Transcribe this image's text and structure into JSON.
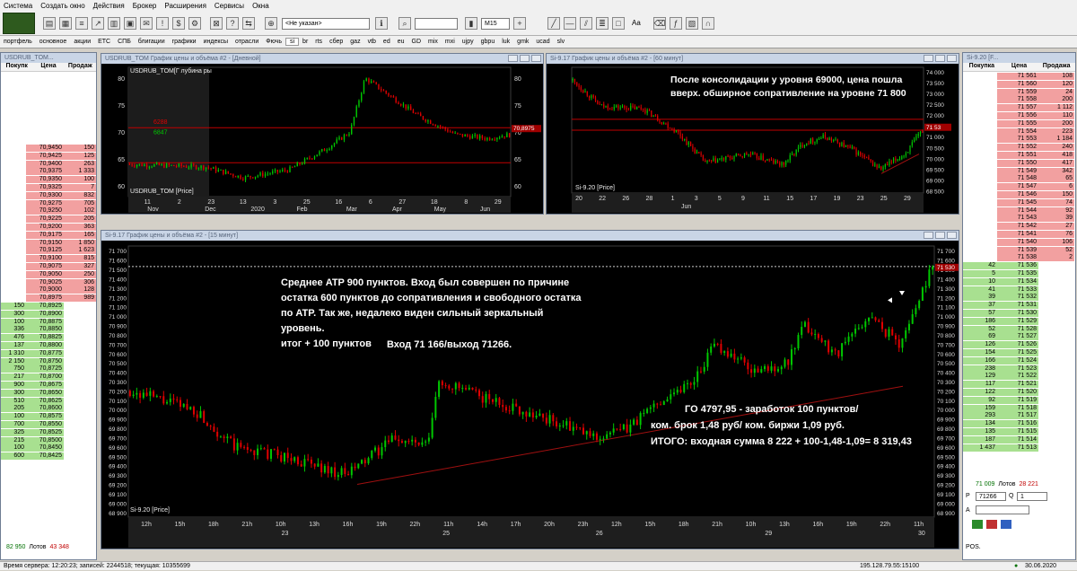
{
  "menu": [
    "Система",
    "Создать окно",
    "Действия",
    "Брокер",
    "Расширения",
    "Сервисы",
    "Окна"
  ],
  "toolbar": {
    "instrument": "<Не указан>",
    "timeframe": "M15",
    "aa": "Aa"
  },
  "tabs": [
    "портфель",
    "основное",
    "акции",
    "ETC",
    "СПБ",
    "блигации",
    "графики",
    "индексы",
    "отрасли",
    "Фючь",
    "si",
    "br",
    "rts",
    "сбер",
    "gaz",
    "vtb",
    "ed",
    "eu",
    "GD",
    "mix",
    "mxi",
    "ujpy",
    "gbpu",
    "luk",
    "gmk",
    "ucad",
    "slv"
  ],
  "left_dom": {
    "title": "USDRUB_TOM...",
    "headers": [
      "Покупк",
      "Цена",
      "Продаж"
    ],
    "asks": [
      [
        "70,9450",
        "150"
      ],
      [
        "70,9425",
        "125"
      ],
      [
        "70,9400",
        "263"
      ],
      [
        "70,9375",
        "1 333"
      ],
      [
        "70,9350",
        "100"
      ],
      [
        "70,9325",
        "7"
      ],
      [
        "70,9300",
        "832"
      ],
      [
        "70,9275",
        "705"
      ],
      [
        "70,9250",
        "102"
      ],
      [
        "70,9225",
        "205"
      ],
      [
        "70,9200",
        "363"
      ],
      [
        "70,9175",
        "165"
      ],
      [
        "70,9150",
        "1 850"
      ],
      [
        "70,9125",
        "1 623"
      ],
      [
        "70,9100",
        "815"
      ],
      [
        "70,9075",
        "327"
      ],
      [
        "70,9050",
        "250"
      ],
      [
        "70,9025",
        "306"
      ],
      [
        "70,9000",
        "128"
      ],
      [
        "70,8975",
        "989"
      ]
    ],
    "bids": [
      [
        "150",
        "70,8925"
      ],
      [
        "300",
        "70,8900"
      ],
      [
        "100",
        "70,8875"
      ],
      [
        "336",
        "70,8850"
      ],
      [
        "476",
        "70,8825"
      ],
      [
        "137",
        "70,8800"
      ],
      [
        "1 310",
        "70,8775"
      ],
      [
        "2 150",
        "70,8750"
      ],
      [
        "750",
        "70,8725"
      ],
      [
        "217",
        "70,8700"
      ],
      [
        "900",
        "70,8675"
      ],
      [
        "300",
        "70,8650"
      ],
      [
        "510",
        "70,8625"
      ],
      [
        "205",
        "70,8600"
      ],
      [
        "100",
        "70,8575"
      ],
      [
        "700",
        "70,8550"
      ],
      [
        "325",
        "70,8525"
      ],
      [
        "215",
        "70,8500"
      ],
      [
        "100",
        "70,8450"
      ],
      [
        "600",
        "70,8425"
      ]
    ],
    "totals": {
      "bid": "82 950",
      "label": "Лотов",
      "ask": "43 348"
    }
  },
  "right_dom": {
    "title": "Si-9.20 [F...",
    "headers": [
      "Покупка",
      "Цена",
      "Продажа"
    ],
    "asks": [
      [
        "71 561",
        "108"
      ],
      [
        "71 560",
        "120"
      ],
      [
        "71 559",
        "24"
      ],
      [
        "71 558",
        "200"
      ],
      [
        "71 557",
        "1 112"
      ],
      [
        "71 556",
        "110"
      ],
      [
        "71 555",
        "200"
      ],
      [
        "71 554",
        "223"
      ],
      [
        "71 553",
        "1 184"
      ],
      [
        "71 552",
        "240"
      ],
      [
        "71 551",
        "418"
      ],
      [
        "71 550",
        "417"
      ],
      [
        "71 549",
        "342"
      ],
      [
        "71 548",
        "65"
      ],
      [
        "71 547",
        "6"
      ],
      [
        "71 546",
        "150"
      ],
      [
        "71 545",
        "74"
      ],
      [
        "71 544",
        "92"
      ],
      [
        "71 543",
        "39"
      ],
      [
        "71 542",
        "27"
      ],
      [
        "71 541",
        "76"
      ],
      [
        "71 540",
        "106"
      ],
      [
        "71 539",
        "52"
      ],
      [
        "71 538",
        "2"
      ]
    ],
    "bids": [
      [
        "42",
        "71 536"
      ],
      [
        "5",
        "71 535"
      ],
      [
        "10",
        "71 534"
      ],
      [
        "41",
        "71 533"
      ],
      [
        "39",
        "71 532"
      ],
      [
        "37",
        "71 531"
      ],
      [
        "57",
        "71 530"
      ],
      [
        "186",
        "71 529"
      ],
      [
        "52",
        "71 528"
      ],
      [
        "69",
        "71 527"
      ],
      [
        "126",
        "71 526"
      ],
      [
        "154",
        "71 525"
      ],
      [
        "166",
        "71 524"
      ],
      [
        "238",
        "71 523"
      ],
      [
        "129",
        "71 522"
      ],
      [
        "117",
        "71 521"
      ],
      [
        "122",
        "71 520"
      ],
      [
        "92",
        "71 519"
      ],
      [
        "159",
        "71 518"
      ],
      [
        "293",
        "71 517"
      ],
      [
        "134",
        "71 516"
      ],
      [
        "135",
        "71 515"
      ],
      [
        "187",
        "71 514"
      ],
      [
        "1 437",
        "71 513"
      ]
    ],
    "totals": {
      "bid": "71 009",
      "label": "Лотов",
      "ask": "28 221"
    },
    "order": {
      "p_label": "P",
      "price": "71266",
      "q_label": "Q",
      "qty": "1",
      "a_label": "A",
      "pos_label": "POS."
    }
  },
  "chart1": {
    "title": "USDRUB_TOM График цены и объёма #2 - [Дневной]",
    "legend_top": "USDRUB_TOM[Г лубина ры",
    "legend_bottom": "USDRUB_TOM [Price]",
    "level1": "6288",
    "level2": "6847",
    "price_tag": "70,8975",
    "yticks": [
      "80",
      "75",
      "70",
      "65",
      "60"
    ],
    "xticks": [
      "11",
      "2",
      "23",
      "13",
      "3",
      "25",
      "16",
      "6",
      "27",
      "18",
      "8",
      "29"
    ],
    "months": [
      "Nov",
      "Dec",
      "2020",
      "Feb",
      "Mar",
      "Apr",
      "May",
      "Jun"
    ]
  },
  "chart2": {
    "title": "Si-9.17 График цены и объёма #2 - [60 минут]",
    "legend": "Si-9.20 [Price]",
    "price_tag": "71 53",
    "annotation": [
      "После консолидации у уровня 69000, цена пошла",
      "вверх.  обширное сопративление на уровне 71 800"
    ],
    "yticks": [
      "74 000",
      "73 500",
      "73 000",
      "72 500",
      "72 000",
      "71 500",
      "71 000",
      "70 500",
      "70 000",
      "69 500",
      "69 000",
      "68 500"
    ],
    "xticks": [
      "20",
      "22",
      "26",
      "28",
      "1",
      "3",
      "5",
      "9",
      "11",
      "15",
      "17",
      "19",
      "23",
      "25",
      "29"
    ],
    "month": "Jun"
  },
  "chart3": {
    "title": "Si-9.17 График цены и объёма #2 - [15 минут]",
    "legend": "Si-9.20 [Price]",
    "price_tag": "71 530",
    "annotation1": [
      "Среднее ATP 900 пунктов. Вход был совершен по причине",
      "остатка 600 пунктов до сопративления и свободного остатка",
      "по ATP. Так же, недалеко виден сильный зеркальный",
      "уровень.",
      "итог + 100 пунктов"
    ],
    "entry": "Вход 71 166/выход 71266.",
    "annotation2": [
      "ГО 4797,95 - заработок 100 пунктов/",
      "ком. брок 1,48 руб/ ком. биржи 1,09 руб.",
      "ИТОГО: входная сумма 8 222 + 100-1,48-1,09= 8 319,43"
    ],
    "yticks": [
      "71 700",
      "71 600",
      "71 500",
      "71 400",
      "71 300",
      "71 200",
      "71 100",
      "71 000",
      "70 900",
      "70 800",
      "70 700",
      "70 600",
      "70 500",
      "70 400",
      "70 300",
      "70 200",
      "70 100",
      "70 000",
      "69 900",
      "69 800",
      "69 700",
      "69 600",
      "69 500",
      "69 400",
      "69 300",
      "69 200",
      "69 100",
      "69 000",
      "68 900"
    ],
    "xticks": [
      "12h",
      "15h",
      "18h",
      "21h",
      "10h",
      "13h",
      "16h",
      "19h",
      "22h",
      "11h",
      "14h",
      "17h",
      "20h",
      "23h",
      "12h",
      "15h",
      "18h",
      "21h",
      "10h",
      "13h",
      "16h",
      "19h",
      "22h",
      "11h"
    ],
    "days": [
      "23",
      "25",
      "26",
      "29",
      "30"
    ]
  },
  "status": {
    "left": "Время сервера: 12:20:23; записей: 2244518; текущая: 10355699",
    "ip": "195.128.79.55:15100",
    "date": "30.06.2020"
  },
  "colors": {
    "bull": "#00c800",
    "bear": "#e00000",
    "level": "#c00000",
    "trend": "#a01010"
  }
}
